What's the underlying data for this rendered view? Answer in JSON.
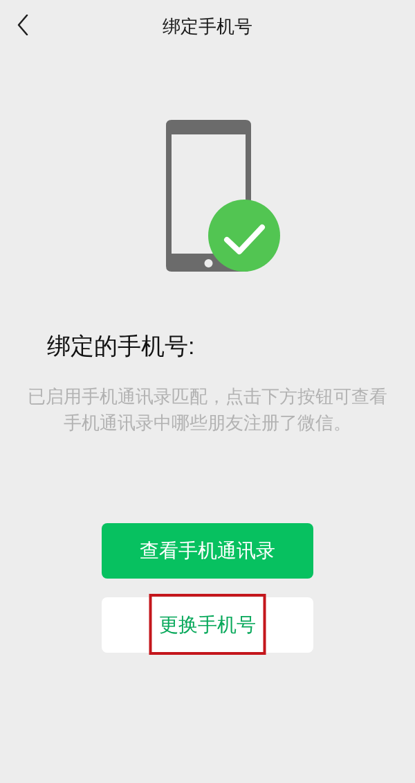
{
  "nav_bar": {
    "title": "绑定手机号"
  },
  "heading": "绑定的手机号:",
  "description": "已启用手机通讯录匹配，点击下方按钮可查看手机通讯录中哪些朋友注册了微信。",
  "buttons": [
    {
      "label": "查看手机通讯录",
      "kind": "primary",
      "highlighted": false
    },
    {
      "label": "更换手机号",
      "kind": "secondary",
      "highlighted": true
    }
  ]
}
